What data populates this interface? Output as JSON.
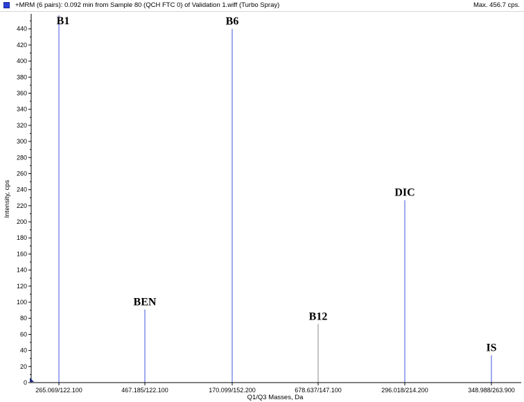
{
  "header": {
    "title": "+MRM (6 pairs): 0.092 min from Sample 80 (QCH FTC 0) of  Validation 1.wiff (Turbo Spray)",
    "max_text": "Max. 456.7 cps."
  },
  "colors": {
    "series": "#3d55e0",
    "series_alt": "#8a8a8a",
    "axis": "#000000",
    "swatch": "#2a3fd6"
  },
  "chart_data": {
    "type": "bar",
    "style": "stick",
    "categories": [
      "265.069/122.100",
      "467.185/122.100",
      "170.099/152.200",
      "678.637/147.100",
      "296.018/214.200",
      "348.988/263.900"
    ],
    "values": [
      457,
      91,
      440,
      73,
      227,
      34
    ],
    "peak_labels": [
      "B1",
      "BEN",
      "B6",
      "B12",
      "DIC",
      "IS"
    ],
    "xlabel": "Q1/Q3 Masses, Da",
    "ylabel": "Intensity, cps",
    "ylim": [
      0,
      457
    ],
    "yticks": [
      0,
      20,
      40,
      60,
      80,
      100,
      120,
      140,
      160,
      180,
      200,
      220,
      240,
      260,
      280,
      300,
      320,
      340,
      360,
      380,
      400,
      420,
      440
    ],
    "grid": false
  }
}
